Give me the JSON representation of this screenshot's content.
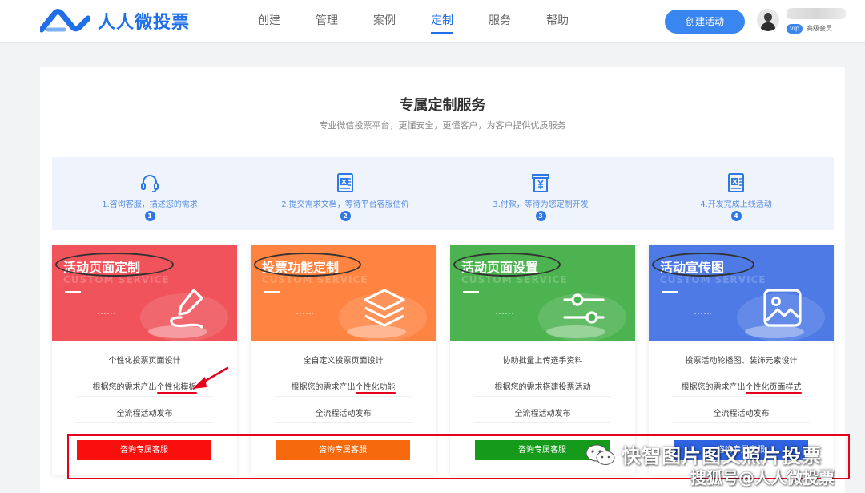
{
  "header": {
    "logo_text": "人人微投票",
    "nav": [
      {
        "label": "创建"
      },
      {
        "label": "管理"
      },
      {
        "label": "案例"
      },
      {
        "label": "定制",
        "active": true
      },
      {
        "label": "服务"
      },
      {
        "label": "帮助"
      }
    ],
    "create_button": "创建活动",
    "vip_label": "vip",
    "member_label": "高级会员"
  },
  "page": {
    "title": "专属定制服务",
    "subtitle": "专业微信投票平台，更懂安全，更懂客户，为客户提供优质服务"
  },
  "steps": [
    {
      "text": "1.咨询客服，描述您的需求",
      "num": "1",
      "icon": "headset-icon"
    },
    {
      "text": "2.提交需求文档，等待平台客服估价",
      "num": "2",
      "icon": "excel-document-icon"
    },
    {
      "text": "3.付款，等待为您定制开发",
      "num": "3",
      "icon": "payment-yuan-icon"
    },
    {
      "text": "4.开发完成上线活动",
      "num": "4",
      "icon": "excel-document-icon"
    }
  ],
  "watermark_banner": "CUSTOM SERVICE",
  "cards": [
    {
      "title": "活动页面定制",
      "icon": "pen-icon",
      "color": "#f0535a",
      "features": [
        "个性化投票页面设计",
        "根据您的需求产出",
        "个性化模板",
        "全流程活动发布"
      ],
      "button": "咨询专属客服",
      "button_color": "#fa0f0f"
    },
    {
      "title": "投票功能定制",
      "icon": "layers-icon",
      "color": "#ff8442",
      "features": [
        "全自定义投票页面设计",
        "根据您的需求产出",
        "个性化功能",
        "全流程活动发布"
      ],
      "button": "咨询专属客服",
      "button_color": "#f66a0d"
    },
    {
      "title": "活动页面设置",
      "icon": "sliders-icon",
      "color": "#4db350",
      "features": [
        "协助批量上传选手资料",
        "根据您的需求搭建投票活动",
        "",
        "全流程活动发布"
      ],
      "button": "咨询专属客服",
      "button_color": "#159a1b"
    },
    {
      "title": "活动宣传图",
      "icon": "image-icon",
      "color": "#4e7ae6",
      "features": [
        "投票活动轮播图、装饰元素设计",
        "根据您的需求产出",
        "个性化页面样式",
        "全流程活动发布"
      ],
      "button": "咨询专属客服",
      "button_color": "#2f63e2"
    }
  ],
  "watermark": {
    "line1": "快智图片图文照片投票",
    "line2": "搜狐号@人人微投票"
  }
}
